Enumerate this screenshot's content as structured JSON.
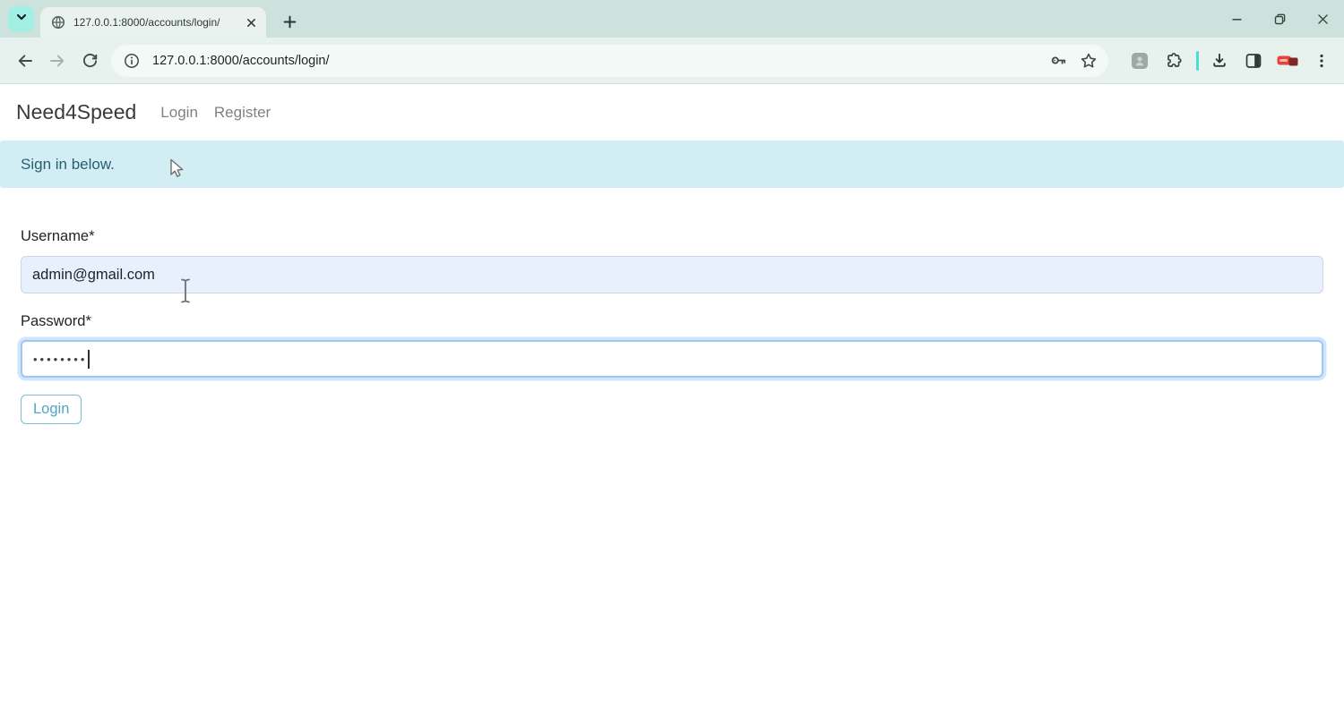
{
  "browser": {
    "tab": {
      "title": "127.0.0.1:8000/accounts/login/"
    },
    "address": {
      "url": "127.0.0.1:8000/accounts/login/"
    }
  },
  "navbar": {
    "brand": "Need4Speed",
    "links": [
      {
        "label": "Login"
      },
      {
        "label": "Register"
      }
    ]
  },
  "alert": {
    "message": "Sign in below."
  },
  "form": {
    "username": {
      "label": "Username*",
      "value": "admin@gmail.com"
    },
    "password": {
      "label": "Password*",
      "masked_value": "••••••••"
    },
    "submit_label": "Login"
  },
  "icons": [
    "chevron-down-icon",
    "globe-favicon-icon",
    "close-tab-icon",
    "new-tab-icon",
    "back-icon",
    "forward-icon",
    "refresh-icon",
    "info-icon",
    "key-icon",
    "star-icon",
    "extension-avatar-icon",
    "puzzle-icon",
    "download-icon",
    "side-panel-icon",
    "extension-badge-icon",
    "menu-dots-icon",
    "minimize-icon",
    "restore-icon",
    "close-window-icon",
    "arrow-cursor",
    "ibeam-cursor"
  ],
  "colors": {
    "chrome_mint": "#cde2dc",
    "chrome_surface": "#e9f2ef",
    "chevron_button_aqua": "#a2efe3",
    "separator_cyan": "#49e0d2",
    "alert_bg": "#d3edf4",
    "alert_text": "#27606f",
    "autofill_bg": "#e8f0fe",
    "focus_border": "#9ec8f2",
    "button_accent": "#4fa6c5",
    "badge_red": "#e64438"
  }
}
